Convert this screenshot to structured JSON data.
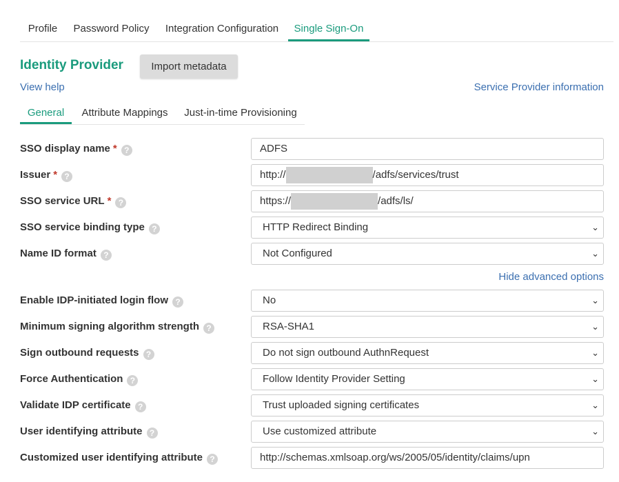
{
  "top_tabs": [
    "Profile",
    "Password Policy",
    "Integration Configuration",
    "Single Sign-On"
  ],
  "idp_title": "Identity Provider",
  "import_button": "Import metadata",
  "view_help": "View help",
  "sp_info": "Service Provider information",
  "sub_tabs": [
    "General",
    "Attribute Mappings",
    "Just-in-time Provisioning"
  ],
  "accent_color": "#1a9b7d",
  "link_color": "#3b6fb0",
  "fields": {
    "sso_display_name": {
      "label": "SSO display name",
      "value": "ADFS"
    },
    "issuer": {
      "label": "Issuer",
      "prefix": "http://",
      "suffix": "/adfs/services/trust"
    },
    "sso_service_url": {
      "label": "SSO service URL",
      "prefix": "https://",
      "suffix": "/adfs/ls/"
    },
    "binding_type": {
      "label": "SSO service binding type",
      "value": "HTTP Redirect Binding"
    },
    "name_id_format": {
      "label": "Name ID format",
      "value": "Not Configured"
    }
  },
  "hide_advanced": "Hide advanced options",
  "advanced": {
    "idp_initiated": {
      "label": "Enable IDP-initiated login flow",
      "value": "No"
    },
    "min_signing": {
      "label": "Minimum signing algorithm strength",
      "value": "RSA-SHA1"
    },
    "sign_outbound": {
      "label": "Sign outbound requests",
      "value": "Do not sign outbound AuthnRequest"
    },
    "force_auth": {
      "label": "Force Authentication",
      "value": "Follow Identity Provider Setting"
    },
    "validate_cert": {
      "label": "Validate IDP certificate",
      "value": "Trust uploaded signing certificates"
    },
    "user_attr": {
      "label": "User identifying attribute",
      "value": "Use customized attribute"
    },
    "custom_user_attr": {
      "label": "Customized user identifying attribute",
      "value": "http://schemas.xmlsoap.org/ws/2005/05/identity/claims/upn"
    }
  },
  "required_mark": "*",
  "help_glyph": "?",
  "chevron_glyph": "⌄"
}
